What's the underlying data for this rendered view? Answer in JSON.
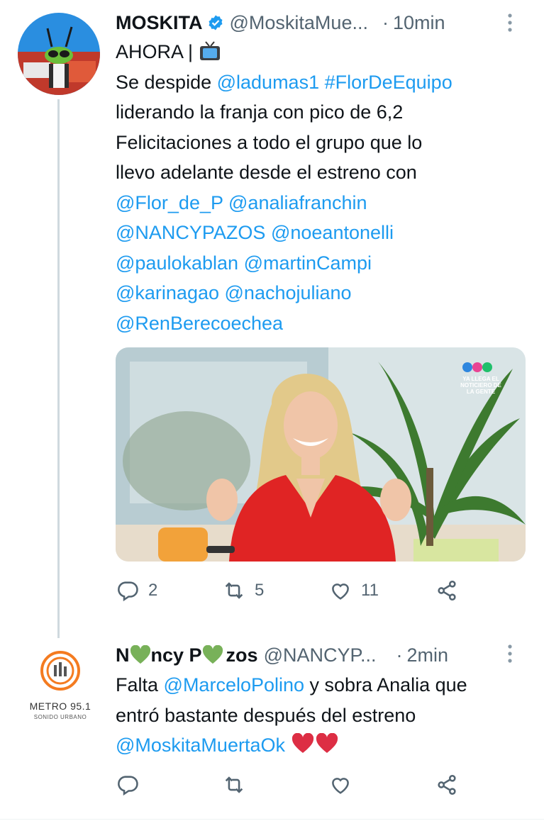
{
  "tweet1": {
    "name": "MOSKITA",
    "handle": "@MoskitaMue...",
    "separator": "·",
    "time": "10min",
    "lines": [
      [
        {
          "t": "AHORA | ",
          "link": false
        }
      ],
      [
        {
          "t": "Se despide ",
          "link": false
        },
        {
          "t": "@ladumas1",
          "link": true
        },
        {
          "t": " ",
          "link": false
        },
        {
          "t": "#FlorDeEquipo",
          "link": true
        }
      ],
      [
        {
          "t": "liderando la franja con pico de 6,2",
          "link": false
        }
      ],
      [
        {
          "t": "Felicitaciones a todo el grupo que lo",
          "link": false
        }
      ],
      [
        {
          "t": "llevo adelante desde el estreno con",
          "link": false
        }
      ],
      [
        {
          "t": "@Flor_de_P",
          "link": true
        },
        {
          "t": " ",
          "link": false
        },
        {
          "t": "@analiafranchin",
          "link": true
        }
      ],
      [
        {
          "t": "@NANCYPAZOS",
          "link": true
        },
        {
          "t": " ",
          "link": false
        },
        {
          "t": "@noeantonelli",
          "link": true
        }
      ],
      [
        {
          "t": "@paulokablan",
          "link": true
        },
        {
          "t": " ",
          "link": false
        },
        {
          "t": "@martinCampi",
          "link": true
        }
      ],
      [
        {
          "t": "@karinagao",
          "link": true
        },
        {
          "t": " ",
          "link": false
        },
        {
          "t": "@nachojuliano",
          "link": true
        }
      ],
      [
        {
          "t": "@RenBerecoechea",
          "link": true
        }
      ]
    ],
    "media_overlay": "YA LLEGA EL NOTICIERO DE LA GENTE",
    "stats": {
      "replies": "2",
      "retweets": "5",
      "likes": "11"
    }
  },
  "tweet2": {
    "name_parts": [
      "N",
      "ncy P",
      "zos"
    ],
    "handle": "@NANCYP...",
    "separator": "·",
    "time": "2min",
    "avatar_text": "METRO 95.1",
    "avatar_subtext": "SONIDO URBANO",
    "lines": [
      [
        {
          "t": "Falta ",
          "link": false
        },
        {
          "t": "@MarceloPolino",
          "link": true
        },
        {
          "t": " y sobra Analia que",
          "link": false
        }
      ],
      [
        {
          "t": "entró bastante después del estreno",
          "link": false
        }
      ],
      [
        {
          "t": "@MoskitaMuertaOk",
          "link": true
        }
      ]
    ]
  },
  "colors": {
    "link": "#1d9bf0",
    "text": "#0f1419",
    "muted": "#536471",
    "verified": "#1d9bf0",
    "green_heart": "#78b159",
    "red_heart": "#dd2e44"
  }
}
